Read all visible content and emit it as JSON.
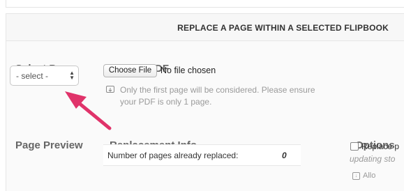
{
  "header": {
    "title": "REPLACE A PAGE WITHIN A SELECTED FLIPBOOK"
  },
  "select_page": {
    "label": "Select Page",
    "selected": "- select -"
  },
  "upload_pdf": {
    "label": "Upload PDF",
    "button": "Choose File",
    "status": "No file chosen",
    "hint_line1": "Only the first page will be considered. Please ensure",
    "hint_line2": "your PDF is only 1 page."
  },
  "page_preview": {
    "label": "Page Preview"
  },
  "replacement_info": {
    "label": "Replacement Info",
    "row_label": "Number of pages already replaced:",
    "row_value": "0"
  },
  "options": {
    "label": "Options",
    "replace_text": "Replace p",
    "updating_text": "updating sto",
    "bottom_text": "Allo"
  },
  "colors": {
    "arrow": "#e0336a"
  }
}
